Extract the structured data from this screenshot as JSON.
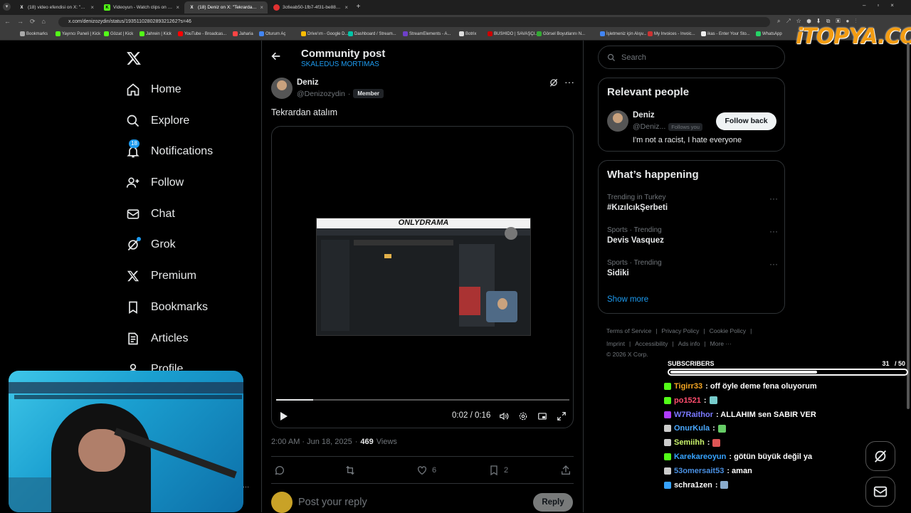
{
  "browser": {
    "tabs": [
      {
        "title": "(18) video efendisi on X: \"Bilal (",
        "favicon": "X",
        "fav_color": "#222"
      },
      {
        "title": "Videoyun - Watch clips on Kick",
        "favicon": "K",
        "fav_color": "#53fc18"
      },
      {
        "title": "(18) Deniz on X: \"Tekrardan atal",
        "favicon": "X",
        "fav_color": "#222"
      },
      {
        "title": "3c6eab50-1fb7-4f31-be88-82d",
        "favicon": "",
        "fav_color": "#e03131"
      }
    ],
    "new_tab_glyph": "+",
    "url": "x.com/denizozydin/status/1935110280289321262?s=46",
    "bookmarks": [
      {
        "label": "Bookmarks",
        "color": "#aaa"
      },
      {
        "label": "Yayıncı Paneli | Kick",
        "color": "#53fc18"
      },
      {
        "label": "Gözat | Kick",
        "color": "#53fc18"
      },
      {
        "label": "Jahrein | Kick",
        "color": "#53fc18"
      },
      {
        "label": "YouTube - Broadcas...",
        "color": "#ff0000"
      },
      {
        "label": "Jaharia",
        "color": "#ff4444"
      },
      {
        "label": "Oturum Aç",
        "color": "#4285f4"
      },
      {
        "label": "Drive'ım - Google D...",
        "color": "#fbbc04"
      },
      {
        "label": "Dashboard / Stream...",
        "color": "#00c4a7"
      },
      {
        "label": "StreamElements - A...",
        "color": "#6e40c9"
      },
      {
        "label": "Botrix",
        "color": "#ddd"
      },
      {
        "label": "BUSHIDO | SAVAŞÇI...",
        "color": "#c00"
      },
      {
        "label": "Görsel Boyutlarını N...",
        "color": "#3a3"
      },
      {
        "label": "İşletmeniz için Alışv...",
        "color": "#4285f4"
      },
      {
        "label": "My Invoices - Invoic...",
        "color": "#c33"
      },
      {
        "label": "ikas - Enter Your Sto...",
        "color": "#eee"
      },
      {
        "label": "WhatsApp",
        "color": "#25d366"
      }
    ]
  },
  "watermark": "iTOPYA.COM",
  "nav": {
    "logo": "X",
    "notification_count": "18",
    "items": [
      {
        "label": "Home"
      },
      {
        "label": "Explore"
      },
      {
        "label": "Notifications"
      },
      {
        "label": "Follow"
      },
      {
        "label": "Chat"
      },
      {
        "label": "Grok"
      },
      {
        "label": "Premium"
      },
      {
        "label": "Bookmarks"
      },
      {
        "label": "Articles"
      },
      {
        "label": "Profile"
      }
    ]
  },
  "post": {
    "header_title": "Community post",
    "community": "SKALEDUS MORTIMAS",
    "author_name": "Deniz",
    "author_handle": "@Denizozydin",
    "handle_separator": "·",
    "role_badge": "Member",
    "text": "Tekrardan atalım",
    "video_inner_title": "ONLYDRAMA",
    "video_time": "0:02 / 0:16",
    "video_progress": 0.125,
    "timestamp": "2:00 AM · Jun 18, 2025",
    "views_count": "469",
    "views_label": "Views",
    "likes": "6",
    "bookmarks": "2",
    "reply_placeholder": "Post your reply",
    "reply_button": "Reply"
  },
  "sidebar": {
    "search_placeholder": "Search",
    "relevant_title": "Relevant people",
    "person": {
      "name": "Deniz",
      "handle": "@Deniz...",
      "follows_you": "Follows you",
      "bio": "I'm not a racist, I hate everyone",
      "button": "Follow back"
    },
    "happening_title": "What’s happening",
    "trends": [
      {
        "meta": "Trending in Turkey",
        "name": "#KızılcıkŞerbeti"
      },
      {
        "meta": "Sports · Trending",
        "name": "Devis Vasquez"
      },
      {
        "meta": "Sports · Trending",
        "name": "Sidiki"
      }
    ],
    "show_more": "Show more",
    "footer_row1": [
      "Terms of Service",
      "|",
      "Privacy Policy",
      "|",
      "Cookie Policy",
      "|"
    ],
    "footer_row2": [
      "Imprint",
      "|",
      "Accessibility",
      "|",
      "Ads info",
      "|",
      "More ···"
    ],
    "copyright": "© 2026 X Corp."
  },
  "stream": {
    "subs_label": "SUBSCRIBERS",
    "subs_count": "31",
    "subs_goal": "/ 50",
    "subs_progress": 0.62,
    "chat": [
      {
        "user": "Tigirr33",
        "color": "#f5a623",
        "badge": "#53fc18",
        "msg": ": off öyle deme fena oluyorum",
        "emote": ""
      },
      {
        "user": "po1521",
        "color": "#ff4d6d",
        "badge": "#53fc18",
        "msg": ":",
        "emote": "#7cc"
      },
      {
        "user": "W7Raithor",
        "color": "#7a7aff",
        "badge": "#b03cff",
        "msg": ": ALLAHIM sen SABIR VER",
        "emote": ""
      },
      {
        "user": "OnurKula",
        "color": "#4aa8ff",
        "badge": "#ccc",
        "msg": ":",
        "emote": "#6c6"
      },
      {
        "user": "Semiihh",
        "color": "#c9f26b",
        "badge": "#ccc",
        "msg": ":",
        "emote": "#d55"
      },
      {
        "user": "Karekareoyun",
        "color": "#36a3ff",
        "badge": "#53fc18",
        "msg": ": götün büyük değil ya",
        "emote": ""
      },
      {
        "user": "53omersait53",
        "color": "#4a90e2",
        "badge": "#ccc",
        "msg": ": aman",
        "emote": ""
      },
      {
        "user": "schra1zen",
        "color": "#ffffff",
        "badge": "#36a3ff",
        "msg": ":",
        "emote": "#8ac"
      }
    ]
  }
}
